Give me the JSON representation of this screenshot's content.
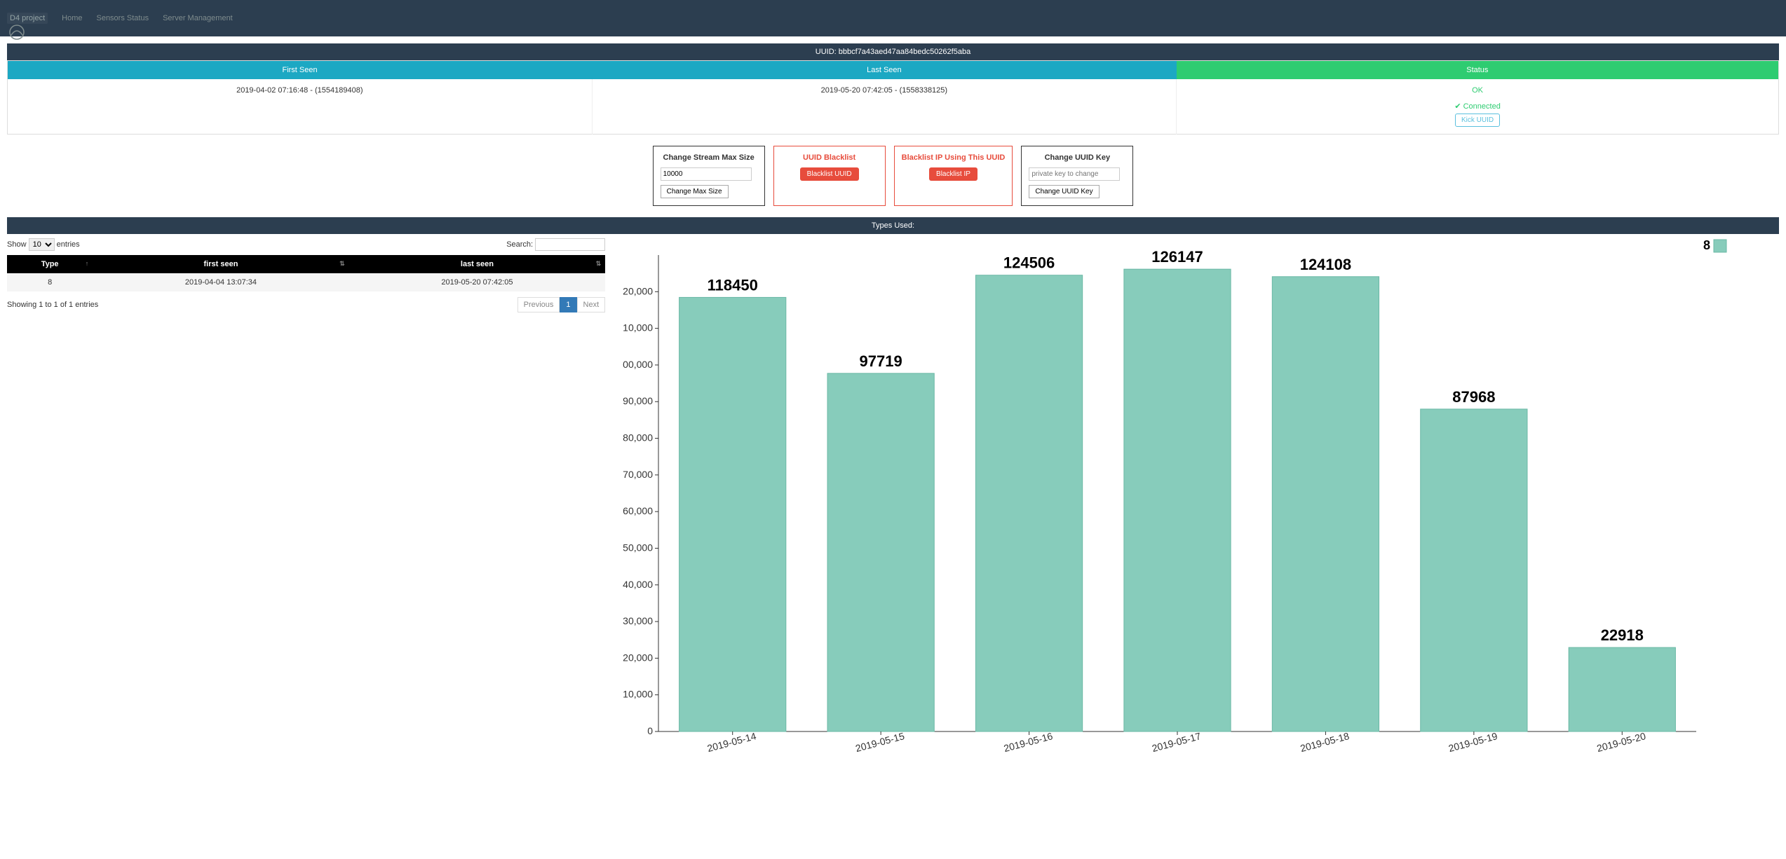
{
  "navbar": {
    "brand": "D4 project",
    "items": [
      "Home",
      "Sensors Status",
      "Server Management"
    ]
  },
  "uuid_bar": "UUID: bbbcf7a43aed47aa84bedc50262f5aba",
  "status_table": {
    "headers": {
      "first_seen": "First Seen",
      "last_seen": "Last Seen",
      "status": "Status"
    },
    "first_seen": "2019-04-02 07:16:48 - (1554189408)",
    "last_seen": "2019-05-20 07:42:05 - (1558338125)",
    "status_ok": "OK",
    "connected": "Connected",
    "kick": "Kick UUID"
  },
  "cards": {
    "max_size": {
      "title": "Change Stream Max Size",
      "value": "10000",
      "btn": "Change Max Size"
    },
    "uuid_blacklist": {
      "title": "UUID Blacklist",
      "btn": "Blacklist UUID"
    },
    "ip_blacklist": {
      "title": "Blacklist IP Using This UUID",
      "btn": "Blacklist IP"
    },
    "uuid_key": {
      "title": "Change UUID Key",
      "placeholder": "private key to change",
      "btn": "Change UUID Key"
    }
  },
  "types_bar": "Types Used:",
  "datatable": {
    "show": "Show",
    "entries": "entries",
    "length_val": "10",
    "search": "Search:",
    "headers": {
      "type": "Type",
      "first_seen": "first seen",
      "last_seen": "last seen"
    },
    "row": {
      "type": "8",
      "first_seen": "2019-04-04 13:07:34",
      "last_seen": "2019-05-20 07:42:05"
    },
    "info": "Showing 1 to 1 of 1 entries",
    "prev": "Previous",
    "page1": "1",
    "next": "Next"
  },
  "chart_data": {
    "type": "bar",
    "categories": [
      "2019-05-14",
      "2019-05-15",
      "2019-05-16",
      "2019-05-17",
      "2019-05-18",
      "2019-05-19",
      "2019-05-20"
    ],
    "values": [
      118450,
      97719,
      124506,
      126147,
      124108,
      87968,
      22918
    ],
    "legend": "8",
    "ylim": [
      0,
      130000
    ],
    "yticks": [
      0,
      10000,
      20000,
      30000,
      40000,
      50000,
      60000,
      70000,
      80000,
      90000,
      100000,
      110000,
      120000
    ],
    "ytick_labels": [
      "0",
      "10,000",
      "20,000",
      "30,000",
      "40,000",
      "50,000",
      "60,000",
      "70,000",
      "80,000",
      "90,000",
      "00,000",
      "10,000",
      "20,000"
    ]
  }
}
